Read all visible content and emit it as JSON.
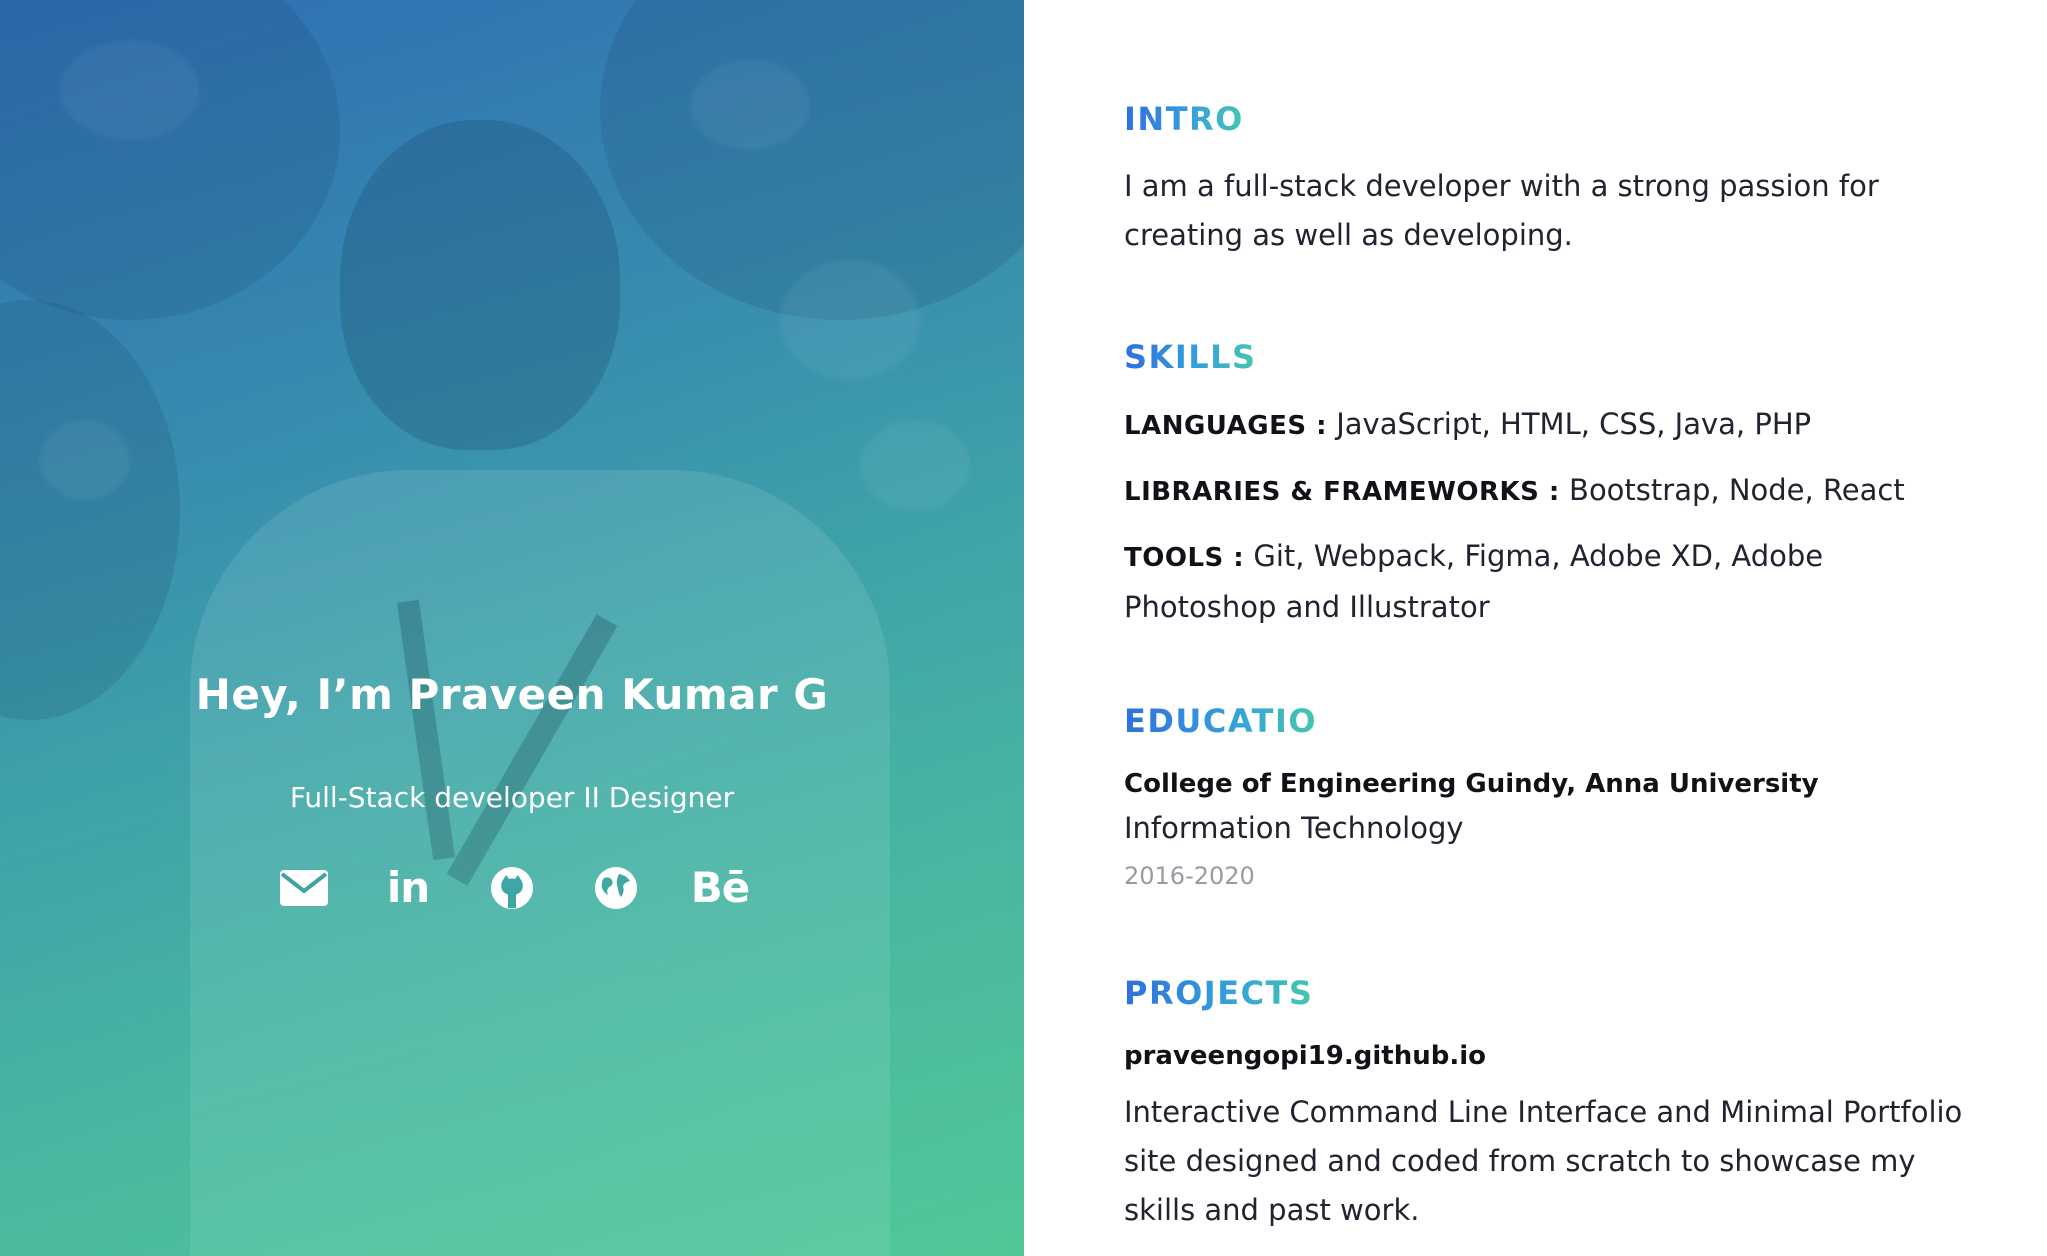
{
  "hero": {
    "name": "Hey, I’m Praveen Kumar G",
    "subtitle": "Full-Stack developer II Designer",
    "social": [
      {
        "name": "email",
        "icon": "envelope-icon"
      },
      {
        "name": "linkedin",
        "icon": "linkedin-icon",
        "glyph": "in"
      },
      {
        "name": "github",
        "icon": "github-icon"
      },
      {
        "name": "website",
        "icon": "globe-icon"
      },
      {
        "name": "behance",
        "icon": "behance-icon",
        "glyph": "Bē"
      }
    ],
    "gradient_colors": [
      "#2f6fb5",
      "#53c79a"
    ]
  },
  "intro": {
    "title": "INTRO",
    "text": "I am a full-stack developer with a strong passion for creating as well as developing."
  },
  "skills": {
    "title": "SKILLS",
    "rows": [
      {
        "key": "LANGUAGES :",
        "value": " JavaScript, HTML, CSS, Java, PHP"
      },
      {
        "key": "LIBRARIES & FRAMEWORKS :",
        "value": " Bootstrap, Node, React"
      },
      {
        "key": "TOOLS :",
        "value": " Git, Webpack, Figma, Adobe XD, Adobe Photoshop and Illustrator"
      }
    ]
  },
  "education": {
    "title": "EDUCATIO",
    "school": "College of Engineering Guindy, Anna University",
    "degree": "Information Technology",
    "years": "2016-2020"
  },
  "projects": {
    "title": "PROJECTS",
    "items": [
      {
        "name": "praveengopi19.github.io",
        "description": "Interactive Command Line Interface and Minimal Portfolio site designed and coded from scratch to showcase my skills and past work."
      }
    ]
  },
  "colors": {
    "heading_gradient_start": "#2f6fe0",
    "heading_gradient_end": "#45c7b0",
    "text": "#222230",
    "muted": "#9a9aa2"
  }
}
